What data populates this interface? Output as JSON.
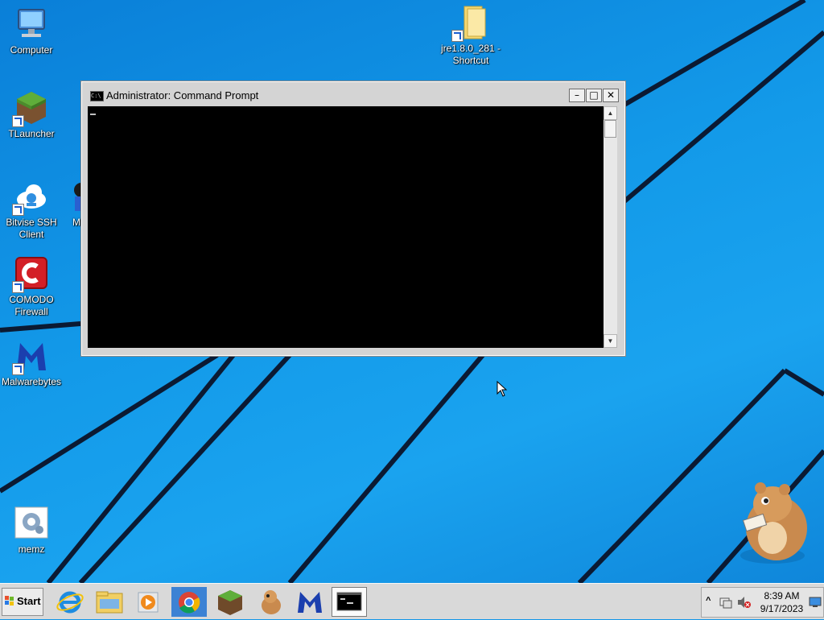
{
  "desktop": {
    "icons": [
      {
        "label": "Computer"
      },
      {
        "label": "TLauncher"
      },
      {
        "label": "Bitvise SSH Client"
      },
      {
        "label": "M"
      },
      {
        "label": "COMODO Firewall"
      },
      {
        "label": "Malwarebytes"
      },
      {
        "label": "memz"
      },
      {
        "label": "jre1.8.0_281 - Shortcut"
      }
    ],
    "wallpaper_color": "#1196e8"
  },
  "cmd_window": {
    "title": "Administrator:  Command Prompt",
    "icon_text": "C:\\",
    "minimize_glyph": "–",
    "maximize_glyph": "□",
    "close_glyph": "✕",
    "scroll_up_glyph": "▲",
    "scroll_down_glyph": "▼"
  },
  "taskbar": {
    "start_label": "Start",
    "apps": [
      {
        "name": "internet-explorer-icon",
        "active": false
      },
      {
        "name": "file-explorer-icon",
        "active": false
      },
      {
        "name": "media-player-icon",
        "active": false
      },
      {
        "name": "chrome-icon",
        "active": false
      },
      {
        "name": "tlauncher-icon",
        "active": false
      },
      {
        "name": "hamster-icon",
        "active": false
      },
      {
        "name": "malwarebytes-icon",
        "active": false
      },
      {
        "name": "command-prompt-icon",
        "active": true
      }
    ],
    "tray": {
      "chevron_glyph": "^",
      "time": "8:39 AM",
      "date": "9/17/2023"
    }
  }
}
